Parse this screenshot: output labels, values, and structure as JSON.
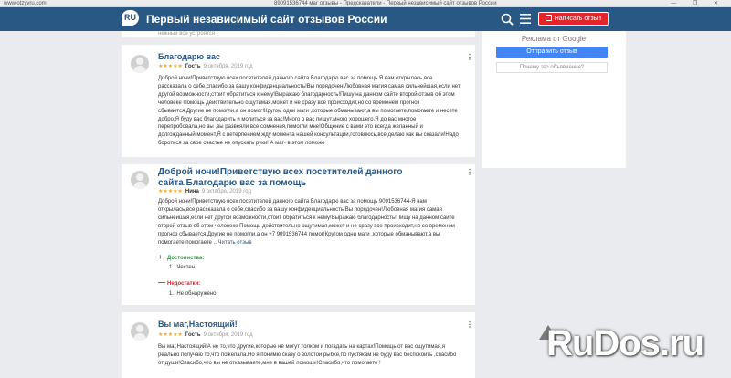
{
  "browser": {
    "url": "www.otzyvru.com",
    "tab_title": "89091536744 маг отзывы - Предсказатели - Первый независимый сайт отзывов России",
    "window_controls": "— ❐ ✕"
  },
  "header": {
    "logo_text": "RU",
    "site_title": "Первый независимый сайт отзывов России",
    "write_button": "Написать отзыв"
  },
  "top_fragment": "нежный все устроятся",
  "reviews": [
    {
      "title": "Благодарю вас",
      "stars": "★★★★★",
      "author": "Гость",
      "date": "9 октября, 2019 год",
      "text": "Доброй ночи!Приветствую всех посетителей данного сайта Благодарю вас за помощь Я вам открылась,все рассказала о себе,спасибо за вашу конфиденциальность!Вы порядочен!Любовная магия самая сильнейшая,если нет другой возможности,стоит обратиться к нему!Выражаю благодарность!Пишу на данном сайте второй отзыв об этом человеке Помощь действительно ощутимая,может и не сразу все происходит,но со временем прогноз сбывается.Другие не помогли,а он помог!Кругом одни маги ,которые обманывают,а вы помогаете,помогаете и несете добро,Я буду вас благодарить и молиться за вас!Много о вас пишут,много хорошего.Я до вас многое перепробовала,но вы ,вы развеяли все сомнения,помогли мне!Общение с вами это всегда желанный и долгожданный момент,Я с нетерпением жду момента нашей консультации,готовлюсь,все делаю как вы сказали!Надо бороться за свое счастье не опускать руки! А маг- в этом поможе"
    },
    {
      "title": "Доброй ночи!Приветствую всех посетителей данного сайта.Благодарю вас за помощь",
      "stars": "★★★★★",
      "author": "Нина",
      "date": "9 октября, 2019 год",
      "text": "Доброй ночи!Приветствую всех посетителей данного сайта Благодарю вас за помощь 9091536744-Я вам открылась,все рассказала о себе,спасибо за вашу конфиденциальность!Вы порядочен!Любовная магия самая сильнейшая,если нет другой возможности,стоит обратиться к нему!Выражаю благодарность!Пишу на данном сайте второй отзыв об этом человеке Помощь действительно ощутимая,может и не сразу все происходит,но со временем прогноз сбывается.Другие не помогли,а он +7 9091536744 помог!Кругом одни маги ,которые обманывают,а вы помогаете,помогаете .. ",
      "read_more": "Читать отзыв",
      "pros_label": "Достоинства:",
      "pros": [
        "1.",
        "Честен"
      ],
      "cons_label": "Недостатки:",
      "cons": [
        "1.",
        "Не обнаружено"
      ]
    },
    {
      "title": "Вы маг,Настоящий!",
      "stars": "★★★★★",
      "author": "Гость",
      "date": "9 октября, 2019 год",
      "text": "Вы маг,Настоящий!А не то,что другие,которые не могут толком и погадать на картах!Помощь от вас ощутимая,я реально получаю то,что пожелала.Но я понимю сказу о золотой рыбке,по пустякам не буду вас беспокоить ,спасибо от души!Спасибо,что вы не отказываете,мне в вашей помощи!Спасибо,что помогаете !"
    }
  ],
  "ad": {
    "label": "Реклама от Google",
    "send_button": "Отправить отзыв",
    "why_button": "Почему это объявление?"
  },
  "watermark": "RuDos.ru"
}
